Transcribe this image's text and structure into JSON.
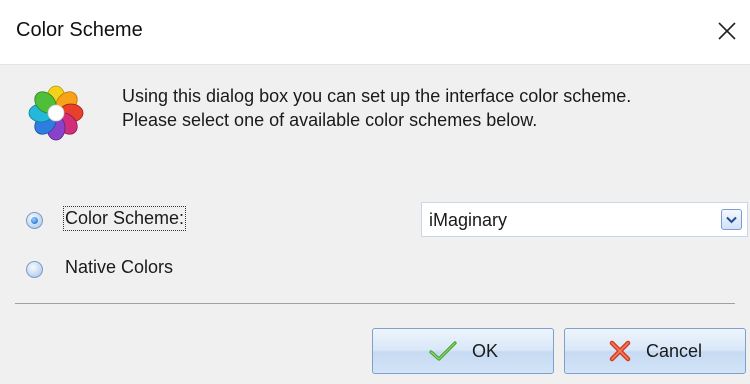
{
  "window": {
    "title": "Color Scheme",
    "close_icon": "close-icon"
  },
  "description": {
    "icon": "flower-icon",
    "line1": "Using this dialog box you can set up the interface color scheme.",
    "line2": "Please select one of available color schemes below."
  },
  "options": {
    "color_scheme_label": "Color Scheme:",
    "color_scheme_selected": true,
    "native_colors_label": "Native Colors",
    "native_colors_selected": false
  },
  "combo": {
    "value": "iMaginary",
    "dropdown_icon": "chevron-down-icon"
  },
  "buttons": {
    "ok_label": "OK",
    "ok_icon": "check-icon",
    "cancel_label": "Cancel",
    "cancel_icon": "cross-icon"
  },
  "colors": {
    "accent": "#2f7fd6",
    "button_border": "#7ea0cd",
    "background": "#f0f0f0"
  }
}
